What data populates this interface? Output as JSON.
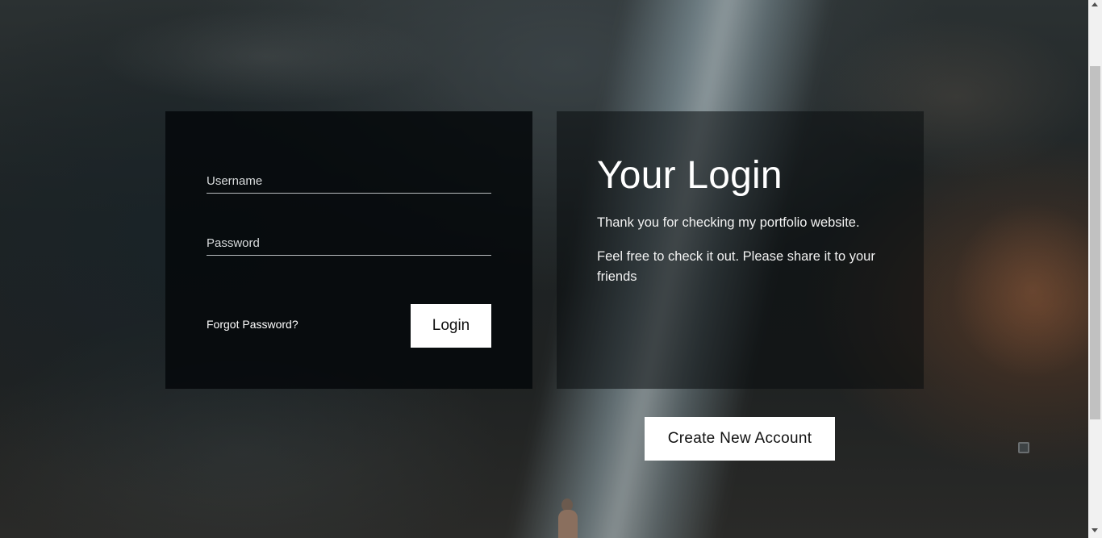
{
  "login_form": {
    "username_placeholder": "Username",
    "password_placeholder": "Password",
    "forgot_label": "Forgot Password?",
    "login_label": "Login"
  },
  "info_panel": {
    "title": "Your Login",
    "paragraph_1": "Thank you for checking my portfolio website.",
    "paragraph_2": "Feel free to check it out. Please share it to your friends"
  },
  "create_account_label": "Create New Account",
  "colors": {
    "button_bg": "#ffffff",
    "panel_dark": "#05080a",
    "text": "#ffffff"
  }
}
